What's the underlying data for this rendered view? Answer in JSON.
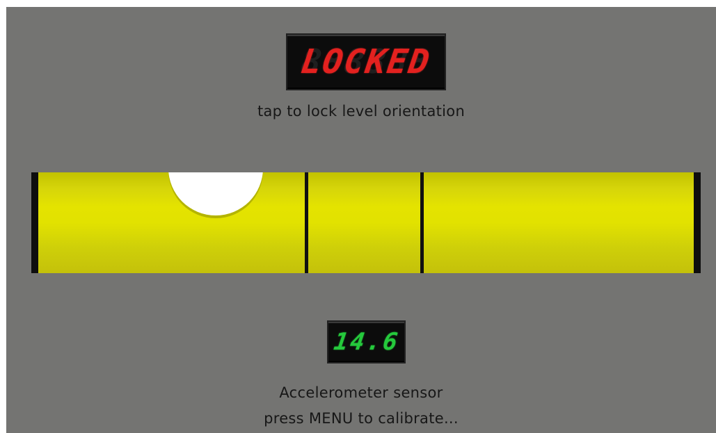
{
  "lock_display": {
    "text": "LOCKED",
    "ghost": "888888",
    "color": "#e3211f"
  },
  "lock_hint": "tap to lock level orientation",
  "level": {
    "bar_color": "#e2e200",
    "bubble_color": "#ffffff"
  },
  "angle_display": {
    "value": "14.6",
    "ghost": "88.8",
    "color": "#25c93c"
  },
  "sensor": {
    "name": "Accelerometer sensor",
    "calibrate_hint": "press MENU to calibrate..."
  }
}
